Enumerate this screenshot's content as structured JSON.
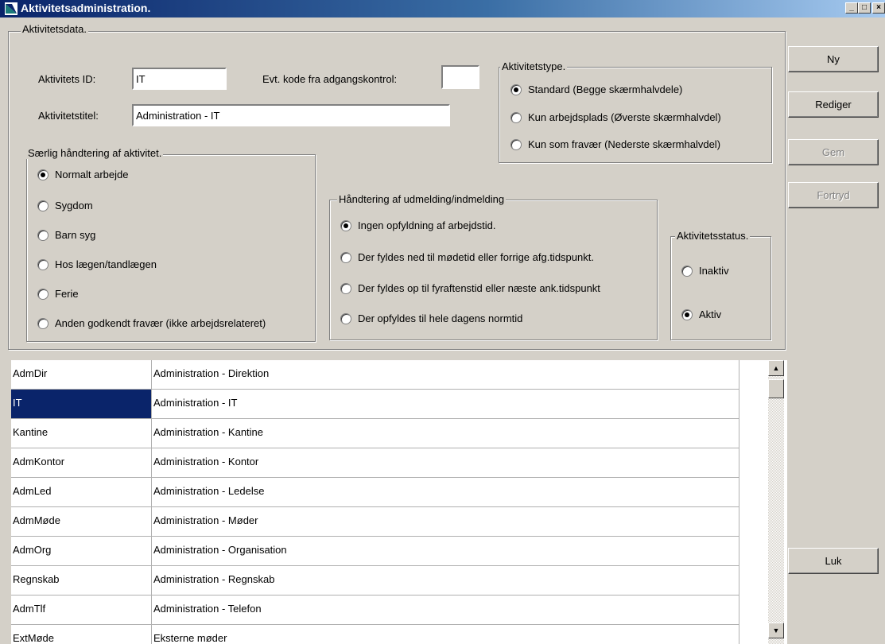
{
  "window": {
    "title": "Aktivitetsadministration.",
    "minimize": "_",
    "maximize": "□",
    "close": "×"
  },
  "activity_data": {
    "legend": "Aktivitetsdata.",
    "id_label": "Aktivitets ID:",
    "id_value": "IT",
    "access_code_label": "Evt. kode fra adgangskontrol:",
    "access_code_value": "",
    "title_label": "Aktivitetstitel:",
    "title_value": "Administration - IT"
  },
  "activity_type": {
    "legend": "Aktivitetstype.",
    "options": [
      {
        "label": "Standard  (Begge skærmhalvdele)",
        "selected": true
      },
      {
        "label": "Kun arbejdsplads (Øverste skærmhalvdel)",
        "selected": false
      },
      {
        "label": "Kun som fravær (Nederste skærmhalvdel)",
        "selected": false
      }
    ]
  },
  "special_handling": {
    "legend": "Særlig håndtering af aktivitet.",
    "options": [
      {
        "label": "Normalt arbejde",
        "selected": true
      },
      {
        "label": "Sygdom",
        "selected": false
      },
      {
        "label": "Barn syg",
        "selected": false
      },
      {
        "label": "Hos lægen/tandlægen",
        "selected": false
      },
      {
        "label": "Ferie",
        "selected": false
      },
      {
        "label": "Anden godkendt fravær (ikke arbejdsrelateret)",
        "selected": false
      }
    ]
  },
  "checkout_handling": {
    "legend": "Håndtering af udmelding/indmelding",
    "options": [
      {
        "label": "Ingen opfyldning af arbejdstid.",
        "selected": true
      },
      {
        "label": "Der fyldes ned til mødetid eller forrige afg.tidspunkt.",
        "selected": false
      },
      {
        "label": "Der fyldes op til fyraftenstid eller næste ank.tidspunkt",
        "selected": false
      },
      {
        "label": "Der opfyldes til hele dagens normtid",
        "selected": false
      }
    ]
  },
  "activity_status": {
    "legend": "Aktivitetsstatus.",
    "options": [
      {
        "label": "Inaktiv",
        "selected": false
      },
      {
        "label": "Aktiv",
        "selected": true
      }
    ]
  },
  "buttons": {
    "new": "Ny",
    "edit": "Rediger",
    "save": "Gem",
    "cancel": "Fortryd",
    "close": "Luk"
  },
  "grid": {
    "rows": [
      {
        "code": "AdmDir",
        "title": "Administration - Direktion"
      },
      {
        "code": "IT",
        "title": "Administration - IT"
      },
      {
        "code": "Kantine",
        "title": "Administration - Kantine"
      },
      {
        "code": "AdmKontor",
        "title": "Administration - Kontor"
      },
      {
        "code": "AdmLed",
        "title": "Administration - Ledelse"
      },
      {
        "code": "AdmMøde",
        "title": "Administration - Møder"
      },
      {
        "code": "AdmOrg",
        "title": "Administration - Organisation"
      },
      {
        "code": "Regnskab",
        "title": "Administration - Regnskab"
      },
      {
        "code": "AdmTlf",
        "title": "Administration - Telefon"
      },
      {
        "code": "ExtMøde",
        "title": "Eksterne møder"
      }
    ],
    "selected_row": 1
  },
  "icons": {
    "app": "app-icon",
    "scroll_up": "scroll-up-icon",
    "scroll_down": "scroll-down-icon"
  }
}
